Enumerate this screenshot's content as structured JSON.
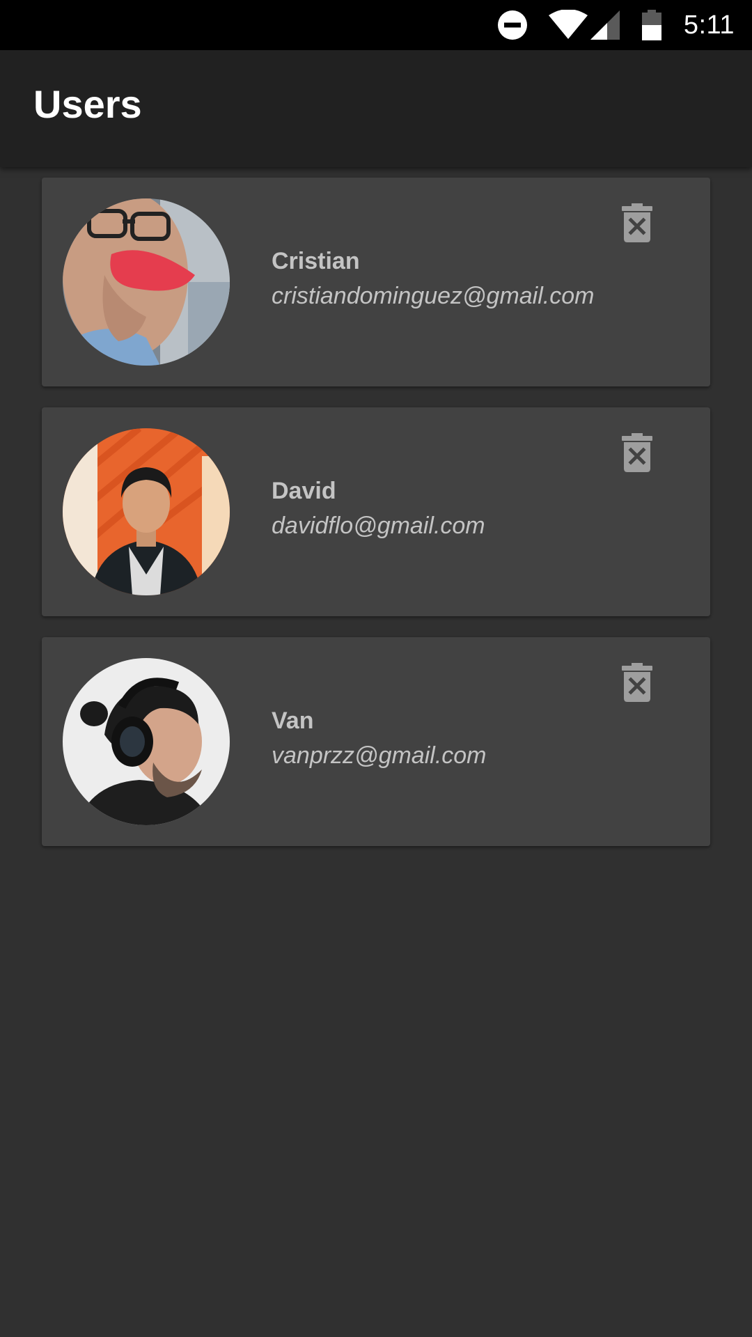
{
  "status_bar": {
    "time": "5:11",
    "icons": [
      "do-not-disturb-icon",
      "wifi-icon",
      "cell-signal-icon",
      "battery-icon"
    ]
  },
  "app_bar": {
    "title": "Users"
  },
  "users": [
    {
      "name": "Cristian",
      "email": "cristiandominguez@gmail.com",
      "avatar": "user-photo",
      "action_icon": "delete-icon"
    },
    {
      "name": "David",
      "email": "davidflo@gmail.com",
      "avatar": "user-photo",
      "action_icon": "delete-icon"
    },
    {
      "name": "Van",
      "email": "vanprzz@gmail.com",
      "avatar": "user-photo",
      "action_icon": "delete-icon"
    }
  ],
  "colors": {
    "status_bar": "#000000",
    "app_bar": "#212121",
    "background": "#303030",
    "card": "#424242",
    "text": "#c4c4c4",
    "icon": "#9e9e9e"
  }
}
